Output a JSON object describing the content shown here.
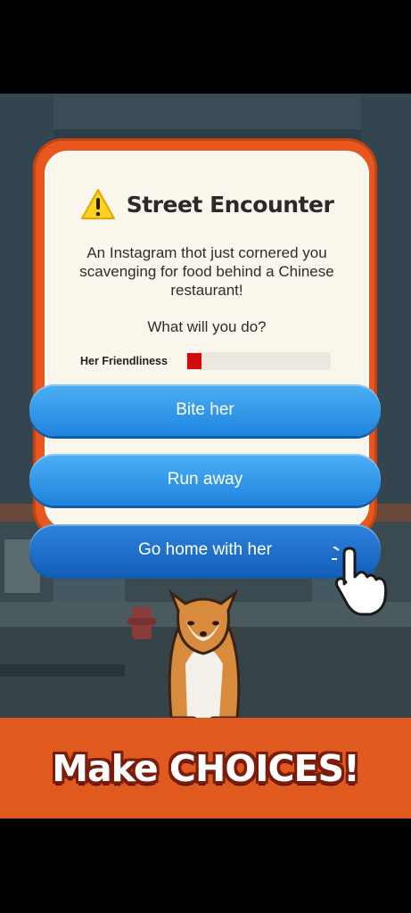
{
  "dialog": {
    "title": "Street Encounter",
    "description": "An Instagram thot just cornered you scavenging for food behind a Chinese restaurant!",
    "question": "What will you do?",
    "meter": {
      "label": "Her Friendliness",
      "fraction": 0.1
    }
  },
  "choices": [
    {
      "label": "Bite her"
    },
    {
      "label": "Run away"
    },
    {
      "label": "Go home with her"
    }
  ],
  "banner": {
    "text": "Make CHOICES!"
  },
  "colors": {
    "dialog_border": "#e8581e",
    "button_blue": "#2f93e8",
    "meter_fill": "#d10b0b",
    "banner_bg": "#e05a1f"
  }
}
